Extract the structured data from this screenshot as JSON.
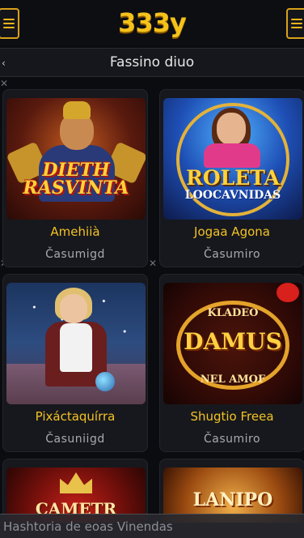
{
  "header": {
    "logo_text": "333y",
    "menu_icon": "hamburger-menu-icon",
    "right_icon": "hamburger-menu-icon"
  },
  "subheader": {
    "title": "Fassino diuo",
    "back_icon": "chevron-left-icon"
  },
  "games": [
    {
      "art_title": "DIETH RASVINTA",
      "title": "Amehiià",
      "provider": "Časumigd"
    },
    {
      "art_title": "ROLETA",
      "art_subtitle": "LOOCAVNIDAS",
      "title": "Jogaa Agona",
      "provider": "Časumiro"
    },
    {
      "title": "Pixáctaquírra",
      "provider": "Časuniigd"
    },
    {
      "art_top": "KLADEO",
      "art_title": "DAMUS",
      "art_bottom": "NEL AMOF",
      "title": "Shugtio Freea",
      "provider": "Časumiro"
    },
    {
      "art_title": "CAMETR"
    },
    {
      "art_title": "LANIPO"
    }
  ],
  "footer": {
    "text": "Hashtoria de eoas Vinendas"
  },
  "colors": {
    "accent": "#f5c21b",
    "background": "#0b0c10",
    "card": "#17181d",
    "provider_text": "#a9a9ad"
  }
}
